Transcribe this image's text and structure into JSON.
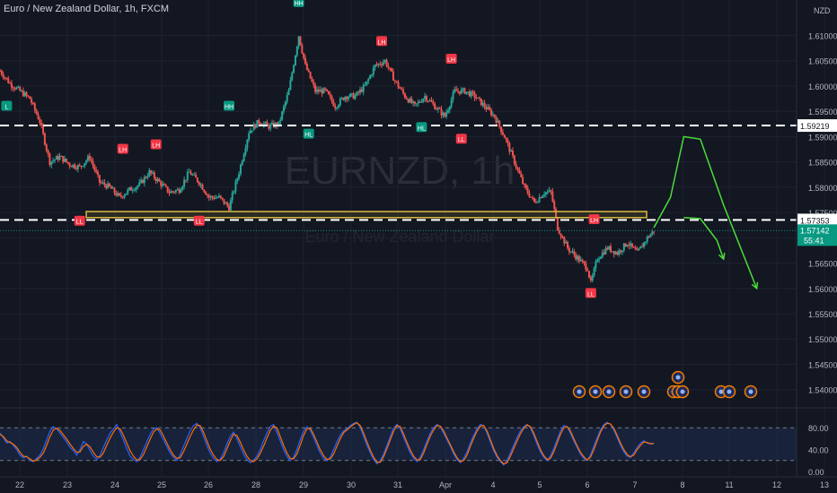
{
  "header": {
    "title": "Euro / New Zealand Dollar, 1h, FXCM"
  },
  "watermark": {
    "symbol": "EURNZD, 1h",
    "name": "Euro / New Zealand Dollar"
  },
  "colors": {
    "background": "#131722",
    "grid": "#1e2230",
    "axis_text": "#b2b5be",
    "up": "#26a69a",
    "down": "#ef5350",
    "level_line": "#ffffff",
    "zone": "#d6b93a",
    "projection": "#4cdd3a",
    "price_badge": "#089981",
    "stoch_k": "#2962ff",
    "stoch_d": "#ff6d00",
    "stoch_band": "#1d2b4d",
    "label_low": "#f23645",
    "label_high": "#089981"
  },
  "chart_data": [
    {
      "type": "candlestick",
      "symbol": "EURNZD",
      "timeframe": "1h",
      "currency": "NZD",
      "y_ticks": [
        "1.61000",
        "1.60500",
        "1.60000",
        "1.59500",
        "1.59000",
        "1.58500",
        "1.58000",
        "1.57500",
        "1.57000",
        "1.56500",
        "1.56000",
        "1.55500",
        "1.55000",
        "1.54500",
        "1.54000"
      ],
      "ylim": [
        1.5364,
        1.617
      ],
      "x_ticks": [
        "22",
        "23",
        "24",
        "25",
        "26",
        "28",
        "29",
        "30",
        "31",
        "Apr",
        "4",
        "5",
        "6",
        "7",
        "8",
        "11",
        "12",
        "13"
      ],
      "price_series": [
        [
          0,
          1.603
        ],
        [
          3,
          1.6005
        ],
        [
          6,
          1.599
        ],
        [
          9,
          1.5975
        ],
        [
          12,
          1.593
        ],
        [
          15,
          1.585
        ],
        [
          18,
          1.586
        ],
        [
          21,
          1.5845
        ],
        [
          24,
          1.584
        ],
        [
          27,
          1.586
        ],
        [
          30,
          1.581
        ],
        [
          33,
          1.58
        ],
        [
          36,
          1.578
        ],
        [
          39,
          1.5795
        ],
        [
          42,
          1.5805
        ],
        [
          45,
          1.583
        ],
        [
          48,
          1.581
        ],
        [
          51,
          1.579
        ],
        [
          54,
          1.5795
        ],
        [
          57,
          1.583
        ],
        [
          60,
          1.581
        ],
        [
          63,
          1.578
        ],
        [
          66,
          1.578
        ],
        [
          69,
          1.576
        ],
        [
          72,
          1.583
        ],
        [
          75,
          1.591
        ],
        [
          78,
          1.593
        ],
        [
          81,
          1.592
        ],
        [
          84,
          1.5925
        ],
        [
          87,
          1.599
        ],
        [
          90,
          1.61
        ],
        [
          92,
          1.604
        ],
        [
          95,
          1.599
        ],
        [
          98,
          1.599
        ],
        [
          101,
          1.596
        ],
        [
          104,
          1.598
        ],
        [
          107,
          1.598
        ],
        [
          110,
          1.6
        ],
        [
          113,
          1.604
        ],
        [
          116,
          1.605
        ],
        [
          119,
          1.601
        ],
        [
          122,
          1.598
        ],
        [
          125,
          1.596
        ],
        [
          128,
          1.598
        ],
        [
          131,
          1.596
        ],
        [
          134,
          1.594
        ],
        [
          137,
          1.599
        ],
        [
          140,
          1.599
        ],
        [
          143,
          1.598
        ],
        [
          146,
          1.596
        ],
        [
          149,
          1.594
        ],
        [
          152,
          1.59
        ],
        [
          155,
          1.585
        ],
        [
          158,
          1.58
        ],
        [
          161,
          1.577
        ],
        [
          164,
          1.579
        ],
        [
          166,
          1.579
        ],
        [
          168,
          1.572
        ],
        [
          171,
          1.568
        ],
        [
          174,
          1.566
        ],
        [
          177,
          1.564
        ],
        [
          178,
          1.561
        ],
        [
          180,
          1.566
        ],
        [
          183,
          1.568
        ],
        [
          186,
          1.567
        ],
        [
          189,
          1.569
        ],
        [
          192,
          1.567
        ],
        [
          195,
          1.57
        ],
        [
          197,
          1.5714
        ]
      ],
      "horizontal_levels": [
        {
          "price": 1.59219,
          "label": "1.59219",
          "style": "dashed"
        },
        {
          "price": 1.57353,
          "label": "1.57353",
          "style": "dashed"
        }
      ],
      "zone": {
        "low": 1.574,
        "high": 1.5752
      },
      "last_price": {
        "value": "1.57142",
        "countdown": "55:41"
      },
      "swing_labels": [
        {
          "t": 2,
          "price": 1.596,
          "text": "L",
          "kind": "high"
        },
        {
          "t": 37,
          "price": 1.5875,
          "text": "LH",
          "kind": "low"
        },
        {
          "t": 47,
          "price": 1.5884,
          "text": "LH",
          "kind": "low"
        },
        {
          "t": 24,
          "price": 1.5733,
          "text": "LL",
          "kind": "low"
        },
        {
          "t": 60,
          "price": 1.5733,
          "text": "LL",
          "kind": "low"
        },
        {
          "t": 69,
          "price": 1.596,
          "text": "HH",
          "kind": "high"
        },
        {
          "t": 90,
          "price": 1.6165,
          "text": "HH",
          "kind": "high"
        },
        {
          "t": 93,
          "price": 1.5905,
          "text": "HL",
          "kind": "high"
        },
        {
          "t": 115,
          "price": 1.6088,
          "text": "LH",
          "kind": "low"
        },
        {
          "t": 127,
          "price": 1.5918,
          "text": "HL",
          "kind": "high"
        },
        {
          "t": 136,
          "price": 1.6053,
          "text": "LH",
          "kind": "low"
        },
        {
          "t": 139,
          "price": 1.5895,
          "text": "LL",
          "kind": "low"
        },
        {
          "t": 179,
          "price": 1.5736,
          "text": "LH",
          "kind": "low"
        },
        {
          "t": 178,
          "price": 1.559,
          "text": "LL",
          "kind": "low"
        }
      ],
      "projection_paths": [
        [
          [
            197,
            1.572
          ],
          [
            202,
            1.578
          ],
          [
            206,
            1.59
          ],
          [
            211,
            1.5895
          ],
          [
            218,
            1.5765
          ],
          [
            228,
            1.56
          ]
        ],
        [
          [
            206,
            1.574
          ],
          [
            211,
            1.5738
          ],
          [
            216,
            1.5695
          ],
          [
            218,
            1.5658
          ]
        ]
      ]
    },
    {
      "type": "line",
      "name": "stochastic",
      "y_ticks": [
        "80.00",
        "40.00",
        "0.00"
      ],
      "ylim": [
        0,
        100
      ],
      "band": [
        20,
        80
      ],
      "series": [
        {
          "key": "k",
          "values": [
            70,
            62,
            52,
            55,
            48,
            40,
            30,
            25,
            28,
            20,
            18,
            24,
            30,
            42,
            58,
            74,
            82,
            78,
            70,
            62,
            54,
            44,
            38,
            30,
            40,
            55,
            50,
            38,
            28,
            22,
            30,
            44,
            58,
            70,
            78,
            86,
            72,
            58,
            42,
            28,
            22,
            18,
            26,
            40,
            54,
            68,
            78,
            80,
            70,
            58,
            46,
            34,
            26,
            20,
            30,
            46,
            60,
            74,
            84,
            88,
            80,
            64,
            48,
            34,
            24,
            18,
            22,
            34,
            50,
            64,
            72,
            60,
            46,
            32,
            22,
            16,
            20,
            28,
            40,
            56,
            70,
            82,
            86,
            72,
            56,
            40,
            28,
            20,
            26,
            40,
            58,
            74,
            82,
            76,
            62,
            48,
            34,
            24,
            20,
            26,
            40,
            54,
            66,
            74,
            78,
            84,
            88,
            90,
            80,
            64,
            48,
            34,
            22,
            14,
            20,
            32,
            48,
            64,
            80,
            86,
            78,
            62,
            48,
            34,
            24,
            18,
            26,
            40,
            56,
            70,
            80,
            86,
            82,
            70,
            58,
            46,
            32,
            22,
            16,
            24,
            36,
            52,
            66,
            78,
            86,
            84,
            70,
            54,
            38,
            26,
            18,
            12,
            20,
            34,
            48,
            62,
            74,
            82,
            86,
            80,
            66,
            50,
            36,
            26,
            20,
            28,
            42,
            58,
            74,
            84,
            82,
            70,
            56,
            44,
            32,
            24,
            20,
            30,
            46,
            62,
            76,
            86,
            90,
            86,
            76,
            62,
            48,
            36,
            28,
            26,
            34,
            44,
            52,
            56,
            52,
            50,
            52
          ]
        },
        {
          "key": "d",
          "values": [
            68,
            64,
            56,
            53,
            50,
            44,
            35,
            28,
            27,
            23,
            19,
            21,
            26,
            34,
            48,
            64,
            76,
            79,
            75,
            67,
            59,
            50,
            42,
            35,
            36,
            46,
            50,
            45,
            35,
            27,
            26,
            34,
            48,
            61,
            72,
            80,
            78,
            66,
            52,
            38,
            28,
            21,
            22,
            31,
            45,
            59,
            72,
            78,
            76,
            65,
            52,
            40,
            30,
            24,
            25,
            36,
            50,
            64,
            76,
            85,
            84,
            72,
            56,
            41,
            30,
            22,
            20,
            27,
            41,
            56,
            68,
            66,
            54,
            40,
            28,
            20,
            18,
            23,
            33,
            46,
            61,
            75,
            83,
            80,
            64,
            48,
            34,
            24,
            23,
            32,
            48,
            66,
            78,
            79,
            68,
            54,
            40,
            29,
            22,
            23,
            32,
            46,
            60,
            71,
            76,
            81,
            86,
            89,
            84,
            70,
            54,
            39,
            26,
            17,
            17,
            27,
            42,
            58,
            74,
            84,
            82,
            68,
            53,
            39,
            28,
            21,
            22,
            34,
            50,
            65,
            76,
            84,
            83,
            74,
            61,
            49,
            36,
            25,
            18,
            20,
            30,
            46,
            61,
            74,
            83,
            84,
            74,
            58,
            42,
            29,
            20,
            14,
            16,
            28,
            42,
            56,
            69,
            79,
            85,
            82,
            70,
            55,
            40,
            29,
            22,
            24,
            36,
            52,
            68,
            80,
            82,
            74,
            60,
            47,
            35,
            27,
            21,
            26,
            40,
            56,
            72,
            83,
            88,
            87,
            79,
            66,
            52,
            40,
            31,
            27,
            30,
            40,
            48,
            54,
            53,
            51,
            51
          ]
        }
      ]
    }
  ]
}
